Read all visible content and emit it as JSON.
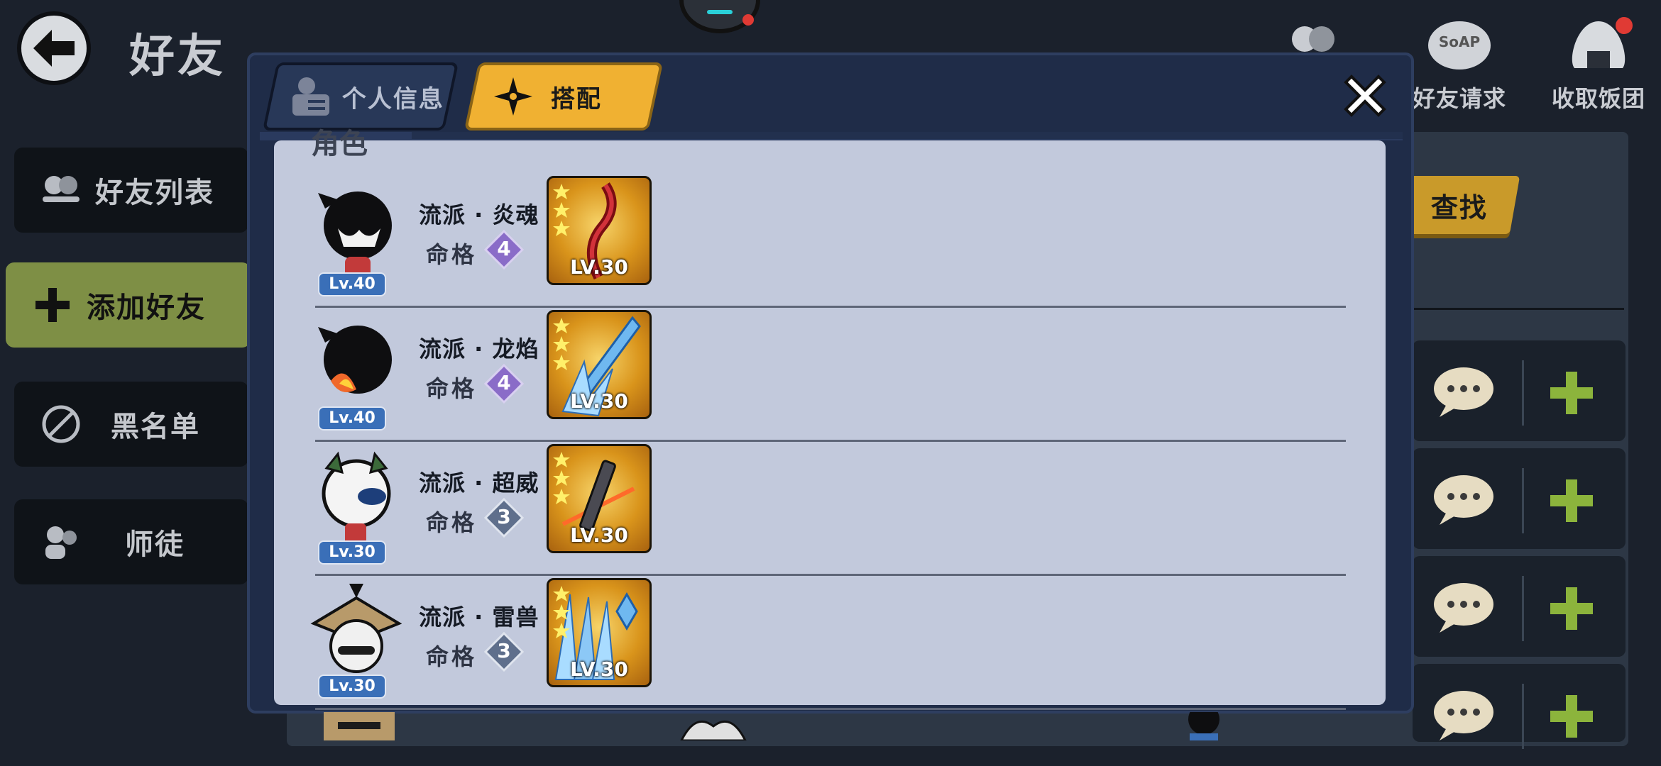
{
  "page": {
    "title": "好友"
  },
  "sidebar": {
    "items": [
      {
        "label": "好友列表",
        "icon": "friends-icon"
      },
      {
        "label": "添加好友",
        "icon": "plus-icon",
        "active": true
      },
      {
        "label": "黑名单",
        "icon": "block-icon"
      },
      {
        "label": "师徒",
        "icon": "mentor-icon"
      }
    ]
  },
  "top_actions": [
    {
      "label": "好友请求",
      "icon": "soap-bubble-icon"
    },
    {
      "label": "收取饭团",
      "icon": "rice-ball-icon",
      "has_notification": true
    }
  ],
  "search": {
    "button_label": "查找"
  },
  "dialog": {
    "tabs": [
      {
        "label": "个人信息",
        "icon": "profile-card-icon",
        "active": false
      },
      {
        "label": "搭配",
        "icon": "shuriken-icon",
        "active": true
      }
    ],
    "section_title": "角色",
    "characters": [
      {
        "level": "Lv.40",
        "school": "流派 · 炎魂",
        "mingge_label": "命格",
        "mingge": "4",
        "weapon_level": "LV.30",
        "weapon_stars": 3,
        "weapon": "crimson-chain-blade"
      },
      {
        "level": "Lv.40",
        "school": "流派 · 龙焰",
        "mingge_label": "命格",
        "mingge": "4",
        "weapon_level": "LV.30",
        "weapon_stars": 3,
        "weapon": "ice-crystal-spear"
      },
      {
        "level": "Lv.30",
        "school": "流派 · 超威",
        "mingge_label": "命格",
        "mingge": "3",
        "weapon_level": "LV.30",
        "weapon_stars": 3,
        "weapon": "light-saber-hilt"
      },
      {
        "level": "Lv.30",
        "school": "流派 · 雷兽",
        "mingge_label": "命格",
        "mingge": "3",
        "weapon_level": "LV.30",
        "weapon_stars": 3,
        "weapon": "ice-claw-blades"
      }
    ]
  },
  "colors": {
    "accent_gold": "#f0b132",
    "sidebar_active": "#7e8f45",
    "level_badge": "#3a6fb8",
    "mingge_4": "#8a6cc8",
    "mingge_3": "#5f6f8c"
  }
}
